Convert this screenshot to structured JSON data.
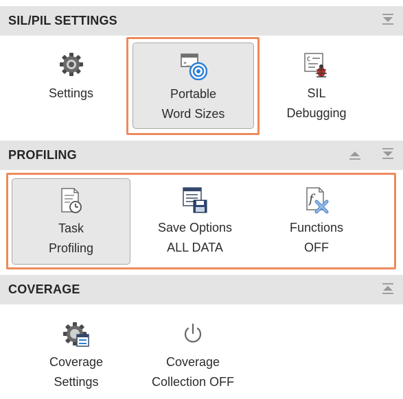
{
  "sections": {
    "sil_pil": {
      "title": "SIL/PIL SETTINGS",
      "items": [
        {
          "label1": "Settings",
          "label2": ""
        },
        {
          "label1": "Portable",
          "label2": "Word Sizes"
        },
        {
          "label1": "SIL",
          "label2": "Debugging"
        }
      ]
    },
    "profiling": {
      "title": "PROFILING",
      "items": [
        {
          "label1": "Task",
          "label2": "Profiling"
        },
        {
          "label1": "Save Options",
          "label2": "ALL DATA"
        },
        {
          "label1": "Functions",
          "label2": "OFF"
        }
      ]
    },
    "coverage": {
      "title": "COVERAGE",
      "items": [
        {
          "label1": "Coverage",
          "label2": "Settings"
        },
        {
          "label1": "Coverage",
          "label2": "Collection OFF"
        }
      ]
    }
  },
  "icons": {
    "settings": "gear-icon",
    "portable_word_sizes": "target-icon",
    "sil_debugging": "bug-icon",
    "task_profiling": "clock-document-icon",
    "save_options": "save-icon",
    "functions": "function-off-icon",
    "coverage_settings": "coverage-gear-icon",
    "coverage_collection": "power-icon",
    "collapse": "collapse-icon",
    "expand": "expand-icon"
  },
  "colors": {
    "header_bg": "#e4e4e4",
    "highlight": "#ee8a5b",
    "pressed_bg": "#e7e7e7",
    "accent_blue": "#2b7fd6"
  }
}
